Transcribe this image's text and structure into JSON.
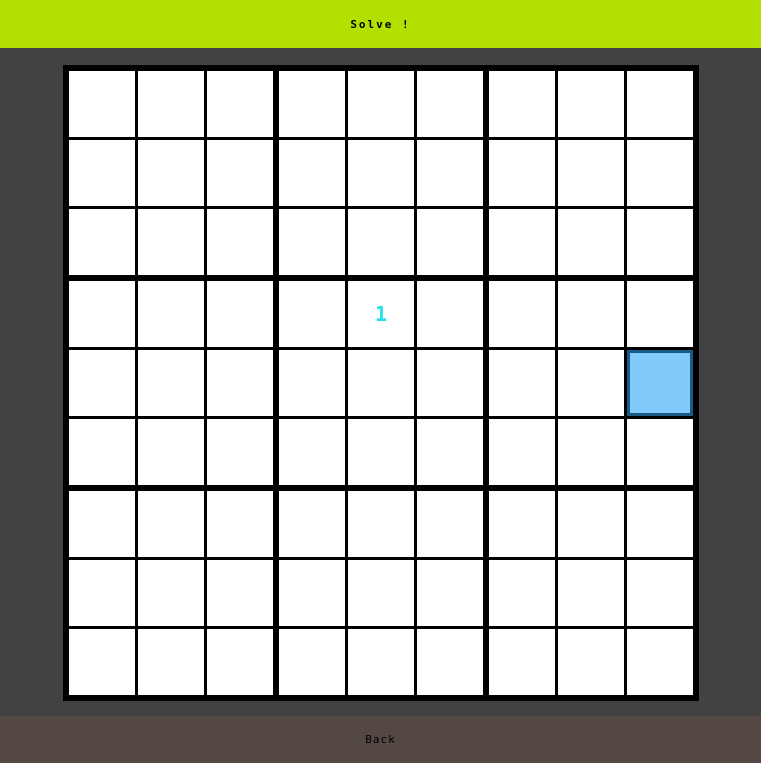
{
  "header": {
    "solve_label": "Solve !"
  },
  "footer": {
    "back_label": "Back"
  },
  "colors": {
    "header_bg": "#b2e000",
    "footer_bg": "#544845",
    "background": "#424242",
    "grid_lines": "#000000",
    "cell_bg": "#ffffff",
    "given_digit": "#22e0f0",
    "selected_cell_bg": "#80cbfc",
    "selected_cell_border": "#1c5a86"
  },
  "board": {
    "size": 9,
    "cells": [
      {
        "row": 3,
        "col": 4,
        "value": "1"
      }
    ],
    "selected": {
      "row": 4,
      "col": 8
    }
  }
}
